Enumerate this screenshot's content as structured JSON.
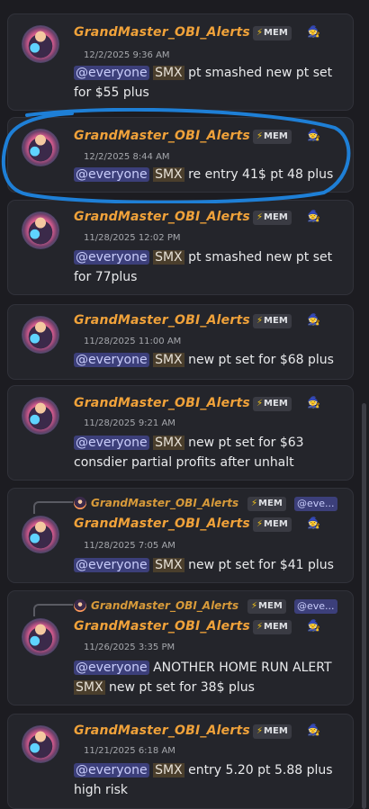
{
  "username": "GrandMaster_OBI_Alerts",
  "tag_label": "MEM",
  "tag_icon": "lightning-icon",
  "badge_icon": "robed-figure-icon",
  "mention": "@everyone",
  "ticker": "SMX",
  "reply_mention": "@eve...",
  "messages": [
    {
      "time": "12/2/2025 9:36 AM",
      "line1": "pt smashed new pt set",
      "line2": "for $55 plus"
    },
    {
      "time": "12/2/2025 8:44 AM",
      "line1": "re entry 41$ pt 48 plus"
    },
    {
      "time": "11/28/2025 12:02 PM",
      "line1": "pt smashed new pt set",
      "line2": "for 77plus"
    },
    {
      "time": "11/28/2025 11:00 AM",
      "line1": "new pt set for $68 plus"
    },
    {
      "time": "11/28/2025 9:21 AM",
      "line1": "new pt set for $63",
      "line2": "consdier partial profits after unhalt"
    },
    {
      "time": "11/28/2025 7:05 AM",
      "line1": "new pt set for $41 plus"
    },
    {
      "time": "11/26/2025 3:35 PM",
      "line1": "ANOTHER HOME RUN ALERT",
      "line2": "new pt set for 38$ plus"
    },
    {
      "time": "11/21/2025 6:18 AM",
      "line1": "entry 5.20 pt 5.88 plus",
      "line2": "high risk"
    }
  ],
  "colors": {
    "background": "#1c1c21",
    "card": "#24252b",
    "username": "#f0a23a",
    "mention_bg": "#3c3f7a",
    "annotation": "#1e7fd6"
  }
}
